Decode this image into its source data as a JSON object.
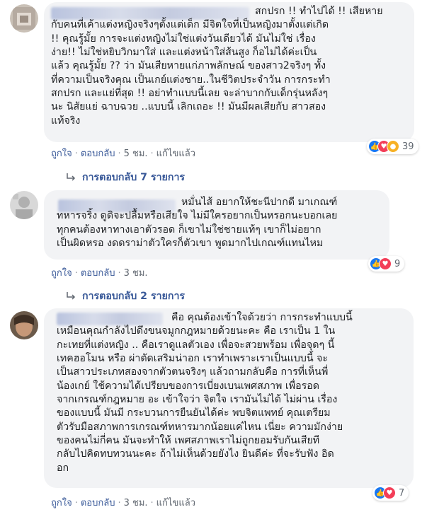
{
  "comments": [
    {
      "lines": [
        "สกปรก !! ทำไปได้ !! เสียหาย",
        "กับคนที่เค้าแต่งหญิงจริงๆตั้งแต่เด็ก มีจิตใจที่เป็นหญิงมาตั้งแต่เกิด",
        "!! คุณรู้มั้ย การจะแต่งหญิงไม่ใช่แต่งวันเดียวได้ มันไม่ใช่ เรื่อง",
        "ง่าย!! ไม่ใช่หยิบวิกมาใส่ และแต่งหน้าใส่ส้นสูง ก็อไม่ได้ค่ะเป็น",
        "แล้ว คุณรู้มั้ย ?? ว่า มันเสียหายแก่ภาพลักษณ์ ของสาว2จริงๆ ทั้ง",
        "ที่ความเป็นจริงคุณ เป็นเกย์แต่งชาย..ในชีวิตประจำวัน การกระทำ",
        "สกปรก และแย่ที่สุด !! อย่าทำแบบนี้เลย จะล่าบากกับเด็กรุ่นหลังๆ",
        "นะ นิสัยแย่ ฉาบฉวย ..แบบนี้ เลิกเถอะ !! มันมีผลเสียกับ สาวสอง",
        "แท้จริง"
      ],
      "actions": {
        "like": "ถูกใจ",
        "reply": "ตอบกลับ",
        "time": "5 ชม.",
        "edited": "แก้ไขแล้ว"
      },
      "reactions": {
        "types": [
          "like-icon",
          "love-icon",
          "wow-icon"
        ],
        "count": "39"
      },
      "replies_label": "การตอบกลับ 7 รายการ"
    },
    {
      "lines": [
        "หมั่นไส้ อยากให้ชะนีปากดี มาเกณฑ์",
        "ทหารจริ้ง ดูดิจะปลื้มหรือเสียใจ ไม่มีใครอยากเป็นหรอกนะบอกเลย",
        "ทุกคนต้องหาทางเอาตัวรอด ก็เขาไม่ใช่ชายแท้ๆ เขาก็ไม่อยาก",
        "เป็นผิดหรอ งดดราม่าตัวใครก็ตัวเขา พูดมากไปเกณฑ์แทนไหม"
      ],
      "actions": {
        "like": "ถูกใจ",
        "reply": "ตอบกลับ",
        "time": "3 ชม."
      },
      "reactions": {
        "types": [
          "like-icon",
          "love-icon"
        ],
        "count": "9"
      },
      "replies_label": "การตอบกลับ 2 รายการ"
    },
    {
      "lines": [
        "คือ คุณต้องเข้าใจด้วยว่า การกระทำแบบนี้",
        "เหมือนคุณกำลังไปดึงขนจมูกกฎหมายด้วยนะคะ คือ เราเป็น 1 ใน",
        "กะเทยที่แต่งหญิง .. คือเราดูแลตัวเอง เพื่อจะสวยพร้อม เพื่อจุดๆ นี้",
        "เทคฮอโมน หรือ ผ่าตัดเสริมน่าอก เราทำเพราะเราเป็นแบบนี้ จะ",
        "เป็นสาวประเภทสองจากตัวตนจริงๆ แล้วถามกลับคือ การที่เห็นพี่",
        "น้องเกย์ ใช้ความได้เปรียบของการเบี่ยงเบนเพศสภาพ เพื่อรอด",
        "จากเกรณฑ์กฎหมาย อะ เข้าใจว่า จิตใจ เรามันไม่ได้ ไม่ผ่าน เรื่อง",
        "ของแบบนี้ มันมี กระบวนการยืนยันได้ค่ะ พบจิตแพทย์ คุณเตรียม",
        "ตัวรับมือสภาพการเกรณฑ์ทหารมากน้อยแค่ไหน เนี่ยะ ความมักง่าย",
        "ของคนไม่กี่คน มันจะทำให้ เพศสภาพเราไม่ถูกยอมรับกันเสียที",
        "กลับไปคิดทบทวนนะคะ ถ้าไม่เห็นด้วยยังไง ยินดีค่ะ ที่จะรับฟัง อิด",
        "อก"
      ],
      "actions": {
        "like": "ถูกใจ",
        "reply": "ตอบกลับ",
        "time": "3 ชม.",
        "edited": "แก้ไขแล้ว"
      },
      "reactions": {
        "types": [
          "like-icon",
          "love-icon"
        ],
        "count": "7"
      }
    }
  ],
  "colors": {
    "link": "#385898",
    "bubble": "#f2f3f5",
    "like": "#1877f2",
    "love": "#f33e58",
    "wow": "#f7b125"
  }
}
